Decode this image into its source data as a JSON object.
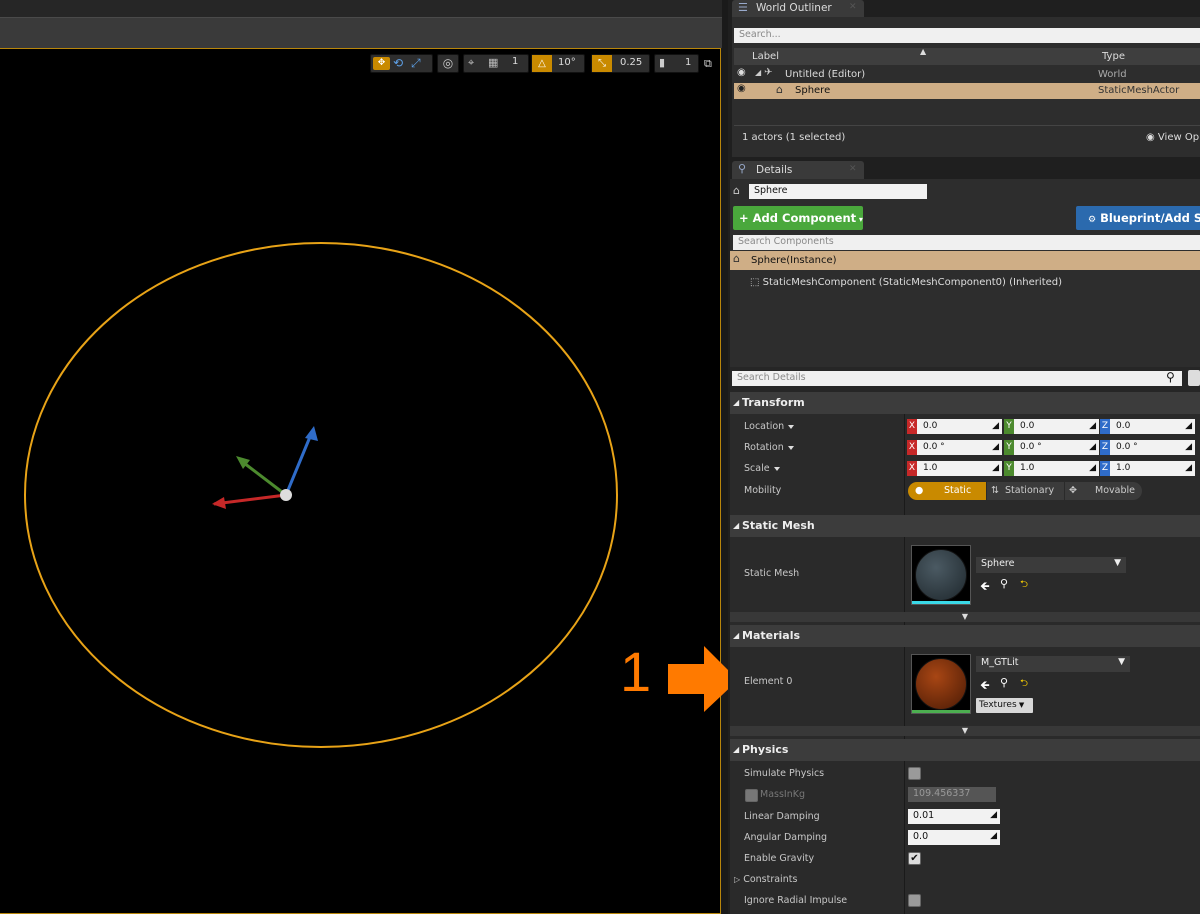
{
  "viewport": {
    "toolbar": {
      "rotate_snap_value": "10°",
      "scale_snap_value": "0.25",
      "camera_speed_value": "1"
    }
  },
  "outliner": {
    "tab_title": "World Outliner",
    "search_placeholder": "Search...",
    "col_label": "Label",
    "col_type": "Type",
    "rows": [
      {
        "label": "Untitled (Editor)",
        "type": "World"
      },
      {
        "label": "Sphere",
        "type": "StaticMeshActor"
      }
    ],
    "status": "1 actors (1 selected)",
    "view_options": "View Op"
  },
  "details": {
    "tab_title": "Details",
    "actor_name": "Sphere",
    "add_component_label": "+ Add Component",
    "blueprint_label": "Blueprint/Add S",
    "search_components_placeholder": "Search Components",
    "instance_label": "Sphere(Instance)",
    "component_label": "StaticMeshComponent (StaticMeshComponent0) (Inherited)",
    "search_details_placeholder": "Search Details"
  },
  "transform": {
    "section": "Transform",
    "location_label": "Location",
    "rotation_label": "Rotation",
    "scale_label": "Scale",
    "mobility_label": "Mobility",
    "axis_x": "X",
    "axis_y": "Y",
    "axis_z": "Z",
    "location": [
      "0.0",
      "0.0",
      "0.0"
    ],
    "rotation": [
      "0.0 °",
      "0.0 °",
      "0.0 °"
    ],
    "scale": [
      "1.0",
      "1.0",
      "1.0"
    ],
    "mobility_static": "Static",
    "mobility_stationary": "Stationary",
    "mobility_movable": "Movable"
  },
  "static_mesh": {
    "section": "Static Mesh",
    "label": "Static Mesh",
    "asset": "Sphere"
  },
  "materials": {
    "section": "Materials",
    "element_label": "Element 0",
    "asset": "M_GTLit",
    "textures_label": "Textures"
  },
  "physics": {
    "section": "Physics",
    "simulate": "Simulate Physics",
    "mass_label": "MassInKg",
    "mass_value": "109.456337",
    "linear_damping_label": "Linear Damping",
    "linear_damping": "0.01",
    "angular_damping_label": "Angular Damping",
    "angular_damping": "0.0",
    "enable_gravity": "Enable Gravity",
    "constraints": "Constraints",
    "ignore_radial": "Ignore Radial Impulse"
  },
  "annotation": {
    "number": "1",
    "arrow_color": "#ff7a00"
  },
  "colors": {
    "selection_outline": "#e8a317",
    "selected_row": "#cfae86",
    "add_component_green": "#4aa83c",
    "blueprint_blue": "#2b6aae",
    "static_orange": "#c98a00"
  }
}
